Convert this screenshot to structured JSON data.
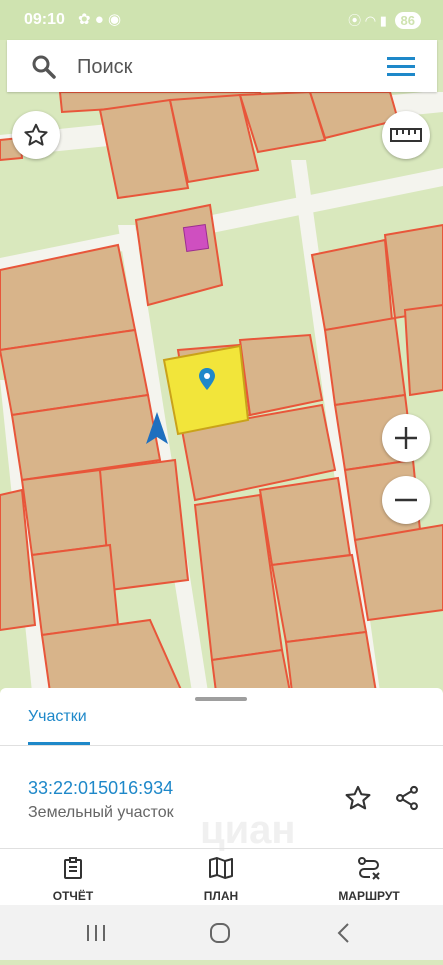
{
  "status": {
    "time": "09:10",
    "battery": "86"
  },
  "search": {
    "placeholder": "Поиск"
  },
  "map": {
    "selected_parcel_color": "#f2e53a",
    "parcel_color": "#d8b48a",
    "boundary_color": "#e8563a",
    "background_color": "#d9e8bd"
  },
  "panel": {
    "tab_label": "Участки",
    "parcel_number": "33:22:015016:934",
    "parcel_type": "Земельный участок",
    "watermark": "циан"
  },
  "bottom_nav": [
    {
      "label": "ОТЧЁТ",
      "icon": "report-icon"
    },
    {
      "label": "ПЛАН",
      "icon": "map-plan-icon"
    },
    {
      "label": "МАРШРУТ",
      "icon": "route-icon"
    }
  ],
  "accent_color": "#1e88c9"
}
